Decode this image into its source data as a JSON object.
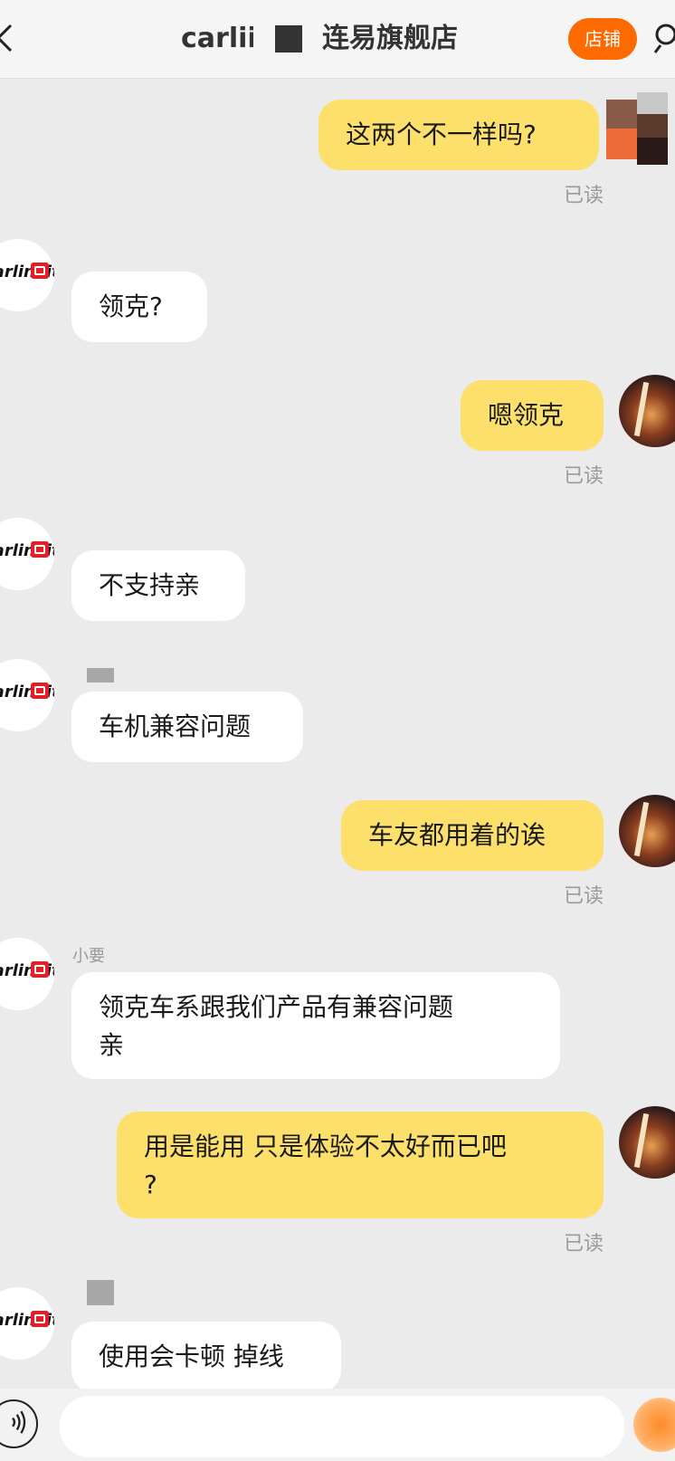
{
  "header": {
    "title_part1": "carlii",
    "title_part2": "连易旗舰店",
    "store_button": "店铺"
  },
  "messages": [
    {
      "side": "out",
      "text": "这两个不一样吗?",
      "status": "已读",
      "avatar": "mosaic"
    },
    {
      "side": "in",
      "text": "领克?"
    },
    {
      "side": "out",
      "text": "嗯领克",
      "status": "已读"
    },
    {
      "side": "in",
      "text": "不支持亲"
    },
    {
      "side": "in",
      "text": "车机兼容问题"
    },
    {
      "side": "out",
      "text": "车友都用着的诶",
      "status": "已读"
    },
    {
      "side": "in",
      "sender": "小要",
      "text": "领克车系跟我们产品有兼容问题\n亲"
    },
    {
      "side": "out",
      "text": "用是能用 只是体验不太好而已吧\n?",
      "status": "已读"
    },
    {
      "side": "in",
      "text": "使用会卡顿 掉线"
    }
  ],
  "shop_logo_text": "carlinkit",
  "input": {
    "placeholder": ""
  },
  "colors": {
    "accent": "#ff6a00",
    "outgoing_bubble": "#fde06b",
    "incoming_bubble": "#ffffff"
  }
}
